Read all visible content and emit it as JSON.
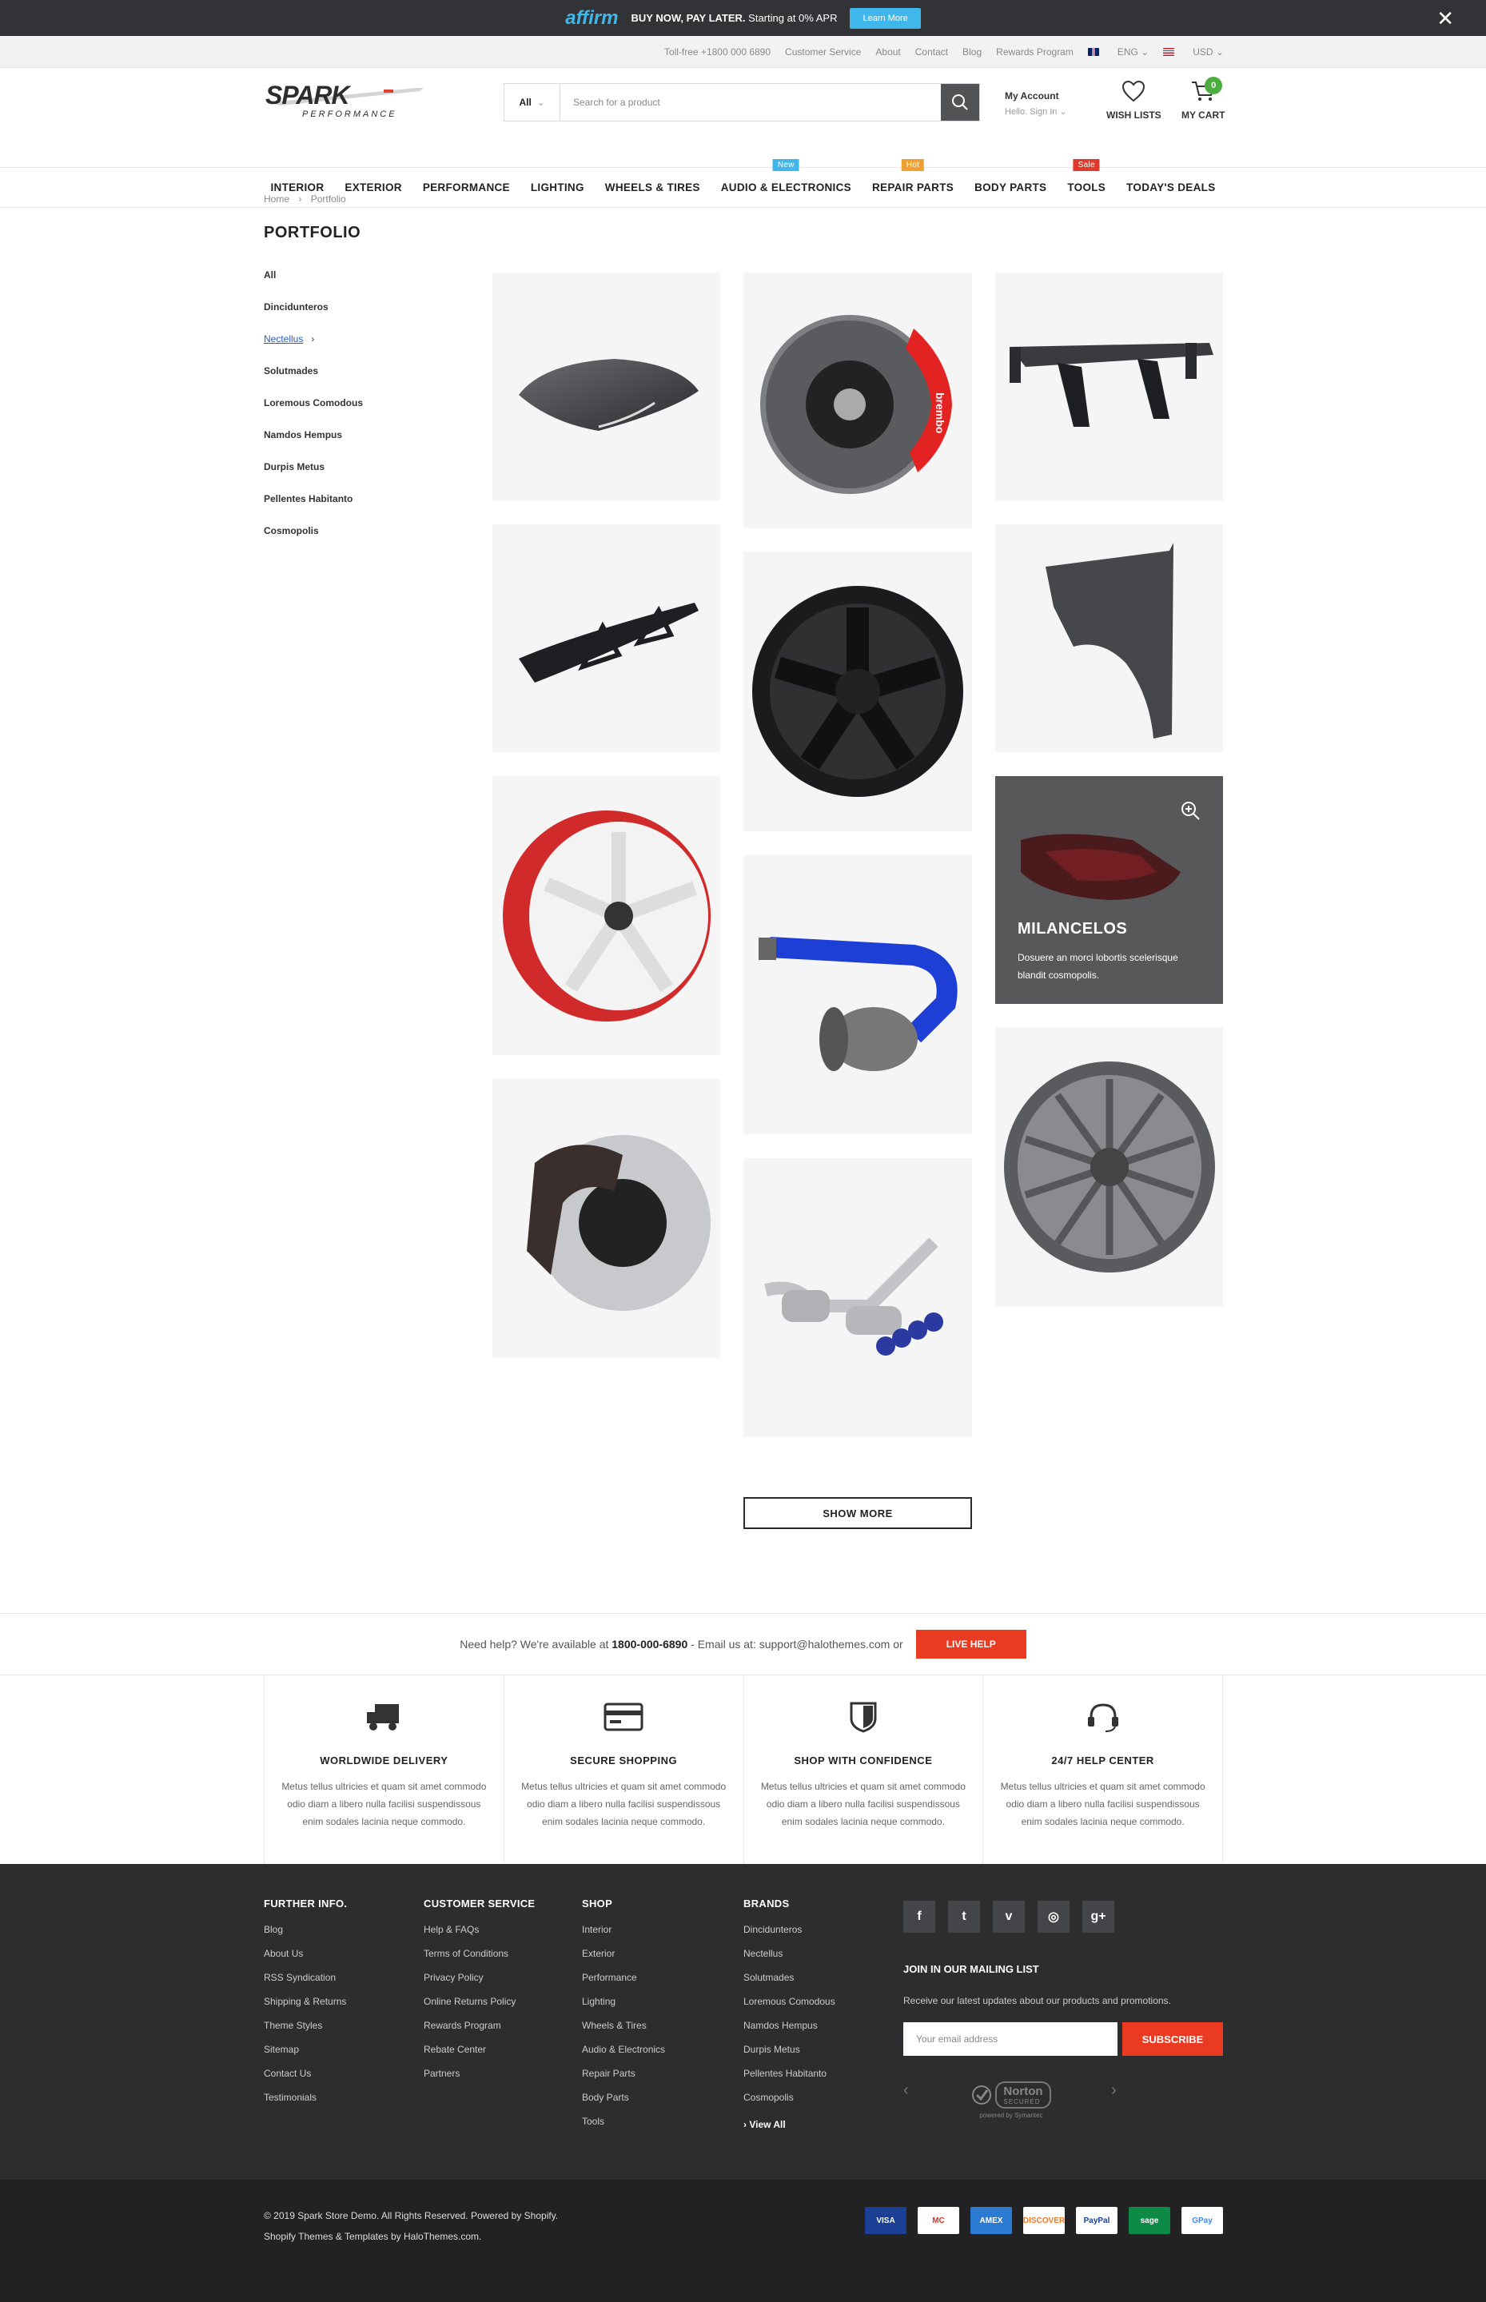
{
  "promo": {
    "brand": "affirm",
    "bold": "BUY NOW, PAY LATER.",
    "text": "Starting at 0% APR",
    "button": "Learn More"
  },
  "topbar": {
    "items": [
      "Toll-free +1800 000 6890",
      "Customer Service",
      "About",
      "Contact",
      "Blog",
      "Rewards Program"
    ],
    "lang": "ENG",
    "currency": "USD"
  },
  "logo": {
    "line1": "SPARK",
    "line2": "PERFORMANCE"
  },
  "search": {
    "category": "All",
    "placeholder": "Search for a product"
  },
  "account": {
    "title": "My Account",
    "sub": "Hello. Sign In"
  },
  "wishlist": "WISH LISTS",
  "cart": {
    "label": "MY CART",
    "count": "0"
  },
  "nav": [
    {
      "label": "INTERIOR"
    },
    {
      "label": "EXTERIOR"
    },
    {
      "label": "PERFORMANCE"
    },
    {
      "label": "LIGHTING"
    },
    {
      "label": "WHEELS & TIRES"
    },
    {
      "label": "AUDIO & ELECTRONICS",
      "tag": "New",
      "tagColor": "#3fb7ea"
    },
    {
      "label": "REPAIR PARTS",
      "tag": "Hot",
      "tagColor": "#f0a030"
    },
    {
      "label": "BODY PARTS"
    },
    {
      "label": "TOOLS",
      "tag": "Sale",
      "tagColor": "#e03a2c"
    },
    {
      "label": "TODAY'S DEALS"
    }
  ],
  "breadcrumb": {
    "home": "Home",
    "current": "Portfolio"
  },
  "page_title": "PORTFOLIO",
  "sidebar": [
    "All",
    "Dincidunteros",
    "Nectellus",
    "Solutmades",
    "Loremous Comodous",
    "Namdos Hempus",
    "Durpis Metus",
    "Pellentes Habitanto",
    "Cosmopolis"
  ],
  "sidebar_active": "Nectellus",
  "hover_tile": {
    "title": "MILANCELOS",
    "text": "Dosuere an morci lobortis scelerisque blandit cosmopolis."
  },
  "show_more": "SHOW MORE",
  "help": {
    "pre": "Need help? We're available at",
    "phone": "1800-000-6890",
    "mid": "- Email us at: support@halothemes.com or",
    "button": "LIVE HELP"
  },
  "features": [
    {
      "icon": "truck-icon",
      "title": "WORLDWIDE DELIVERY",
      "text": "Metus tellus ultricies et quam sit amet commodo odio diam a libero nulla facilisi suspendissous enim sodales lacinia neque commodo."
    },
    {
      "icon": "credit-card-icon",
      "title": "SECURE SHOPPING",
      "text": "Metus tellus ultricies et quam sit amet commodo odio diam a libero nulla facilisi suspendissous enim sodales lacinia neque commodo."
    },
    {
      "icon": "shield-icon",
      "title": "SHOP WITH CONFIDENCE",
      "text": "Metus tellus ultricies et quam sit amet commodo odio diam a libero nulla facilisi suspendissous enim sodales lacinia neque commodo."
    },
    {
      "icon": "headset-icon",
      "title": "24/7 HELP CENTER",
      "text": "Metus tellus ultricies et quam sit amet commodo odio diam a libero nulla facilisi suspendissous enim sodales lacinia neque commodo."
    }
  ],
  "footer": {
    "further": {
      "title": "FURTHER INFO.",
      "items": [
        "Blog",
        "About Us",
        "RSS Syndication",
        "Shipping & Returns",
        "Theme Styles",
        "Sitemap",
        "Contact Us",
        "Testimonials"
      ]
    },
    "service": {
      "title": "CUSTOMER SERVICE",
      "items": [
        "Help & FAQs",
        "Terms of Conditions",
        "Privacy Policy",
        "Online Returns Policy",
        "Rewards Program",
        "Rebate Center",
        "Partners"
      ]
    },
    "shop": {
      "title": "SHOP",
      "items": [
        "Interior",
        "Exterior",
        "Performance",
        "Lighting",
        "Wheels & Tires",
        "Audio & Electronics",
        "Repair Parts",
        "Body Parts",
        "Tools"
      ]
    },
    "brands": {
      "title": "BRANDS",
      "items": [
        "Dincidunteros",
        "Nectellus",
        "Solutmades",
        "Loremous Comodous",
        "Namdos Hempus",
        "Durpis Metus",
        "Pellentes Habitanto",
        "Cosmopolis"
      ],
      "view_all": "View All"
    },
    "mailing": {
      "title": "JOIN IN OUR MAILING LIST",
      "text": "Receive our latest updates about our products and promotions.",
      "placeholder": "Your email address",
      "button": "SUBSCRIBE"
    },
    "norton": {
      "line1": "Norton",
      "line2": "SECURED",
      "line3": "powered by Symantec"
    }
  },
  "copyright": {
    "line1": "© 2019 Spark Store Demo. All Rights Reserved. Powered by Shopify.",
    "line2": "Shopify Themes & Templates by HaloThemes.com."
  },
  "payments": [
    {
      "label": "VISA",
      "bg": "#1a3f95"
    },
    {
      "label": "MC",
      "bg": "#ffffff"
    },
    {
      "label": "AMEX",
      "bg": "#2a7bd1"
    },
    {
      "label": "DISCOVER",
      "bg": "#ffffff"
    },
    {
      "label": "PayPal",
      "bg": "#ffffff"
    },
    {
      "label": "sage",
      "bg": "#0c8a46"
    },
    {
      "label": "GPay",
      "bg": "#ffffff"
    }
  ]
}
